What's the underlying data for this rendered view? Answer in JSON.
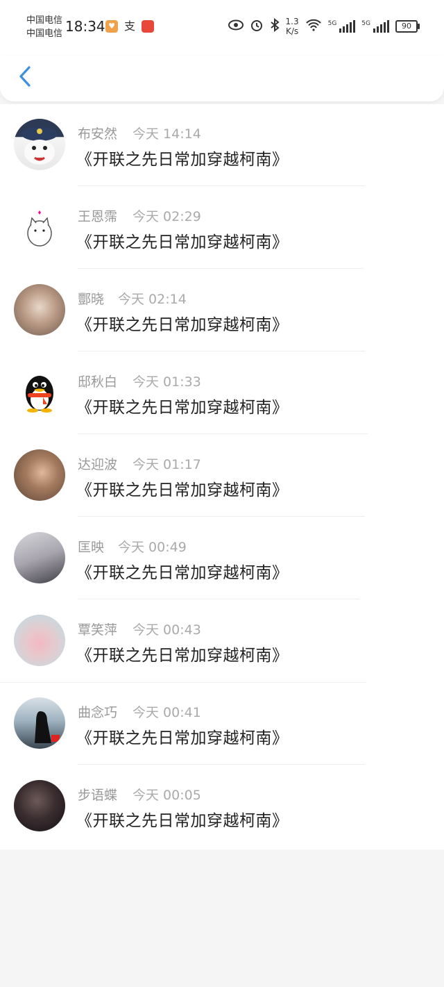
{
  "status_bar": {
    "carrier1": "中国电信",
    "carrier2": "中国电信",
    "time": "18:34",
    "app_icon_pay": "支",
    "net_speed_value": "1.3",
    "net_speed_unit": "K/s",
    "sim1_type": "5G",
    "sim2_type": "5G",
    "battery": "90",
    "icons": [
      "eye-icon",
      "alarm-icon",
      "bluetooth-icon",
      "wifi-icon",
      "signal-icon",
      "signal-icon",
      "battery-icon"
    ]
  },
  "nav": {
    "back_icon": "chevron-left-icon",
    "accent_color": "#3d8fe0"
  },
  "comments": [
    {
      "name": "布安然",
      "time": "今天 14:14",
      "text": "《开联之先日常加穿越柯南》"
    },
    {
      "name": "王恩霈",
      "time": "今天 02:29",
      "text": "《开联之先日常加穿越柯南》"
    },
    {
      "name": "酆晓",
      "time": "今天 02:14",
      "text": "《开联之先日常加穿越柯南》"
    },
    {
      "name": "邸秋白",
      "time": "今天 01:33",
      "text": "《开联之先日常加穿越柯南》"
    },
    {
      "name": "达迎波",
      "time": "今天 01:17",
      "text": "《开联之先日常加穿越柯南》"
    },
    {
      "name": "匡映",
      "time": "今天 00:49",
      "text": "《开联之先日常加穿越柯南》"
    },
    {
      "name": "覃笑萍",
      "time": "今天 00:43",
      "text": "《开联之先日常加穿越柯南》"
    },
    {
      "name": "曲念巧",
      "time": "今天 00:41",
      "text": "《开联之先日常加穿越柯南》"
    },
    {
      "name": "步语蝶",
      "time": "今天 00:05",
      "text": "《开联之先日常加穿越柯南》"
    }
  ]
}
